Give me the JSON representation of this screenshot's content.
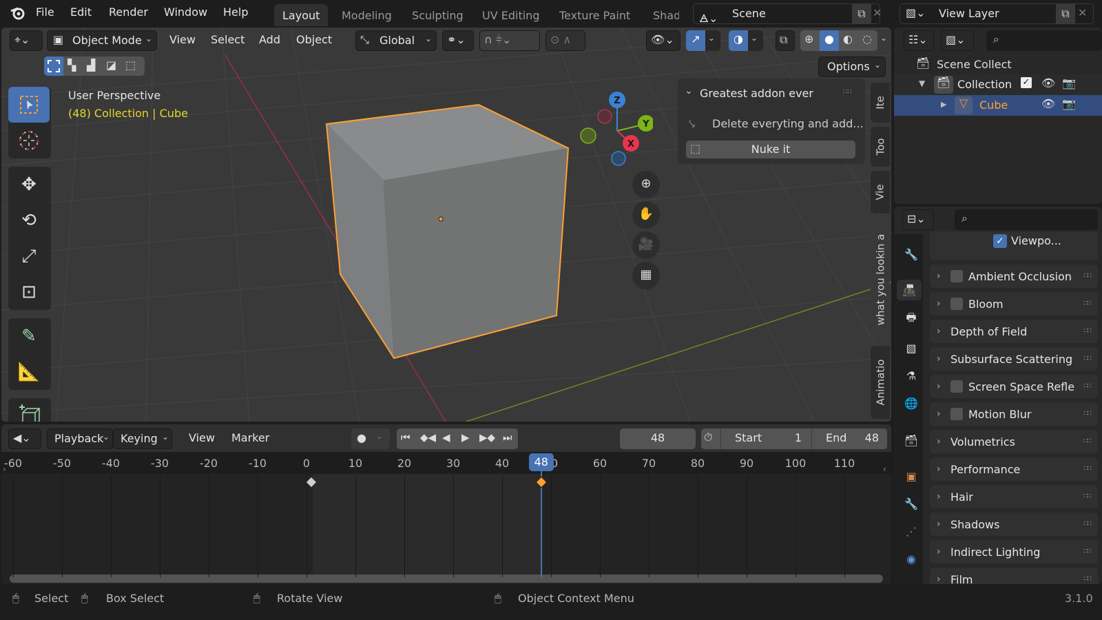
{
  "topbar": {
    "menu": [
      "File",
      "Edit",
      "Render",
      "Window",
      "Help"
    ],
    "workspaces": [
      "Layout",
      "Modeling",
      "Sculpting",
      "UV Editing",
      "Texture Paint",
      "Shadi"
    ],
    "active_workspace": "Layout",
    "scene": "Scene",
    "view_layer": "View Layer"
  },
  "viewport": {
    "mode": "Object Mode",
    "menus": [
      "View",
      "Select",
      "Add",
      "Object"
    ],
    "orientation": "Global",
    "options_label": "Options",
    "title": "User Perspective",
    "subtitle": "(48) Collection | Cube",
    "gizmo": {
      "x": "X",
      "y": "Y",
      "z": "Z"
    },
    "addon_panel": {
      "title": "Greatest addon ever",
      "operator": "Delete everyting and add...",
      "button": "Nuke it"
    },
    "side_tabs": [
      "Ite",
      "Too",
      "Vie",
      "what you lookin a",
      "Animatio"
    ],
    "tools": [
      "select-box",
      "cursor",
      "move",
      "rotate",
      "scale",
      "transform",
      "annotate",
      "measure",
      "add-cube"
    ]
  },
  "outliner": {
    "items": [
      {
        "label": "Scene Collect",
        "level": 0
      },
      {
        "label": "Collection",
        "level": 1
      },
      {
        "label": "Cube",
        "level": 2,
        "selected": true
      }
    ]
  },
  "properties": {
    "viewport_checkbox": "Viewpo...",
    "panels": [
      {
        "label": "Ambient Occlusion",
        "checkbox": true
      },
      {
        "label": "Bloom",
        "checkbox": true
      },
      {
        "label": "Depth of Field",
        "checkbox": false
      },
      {
        "label": "Subsurface Scattering",
        "checkbox": false
      },
      {
        "label": "Screen Space Refle",
        "checkbox": true
      },
      {
        "label": "Motion Blur",
        "checkbox": true
      },
      {
        "label": "Volumetrics",
        "checkbox": false
      },
      {
        "label": "Performance",
        "checkbox": false
      },
      {
        "label": "Hair",
        "checkbox": false
      },
      {
        "label": "Shadows",
        "checkbox": false
      },
      {
        "label": "Indirect Lighting",
        "checkbox": false
      },
      {
        "label": "Film",
        "checkbox": false
      }
    ]
  },
  "timeline": {
    "menus": [
      "Playback",
      "Keying",
      "View",
      "Marker"
    ],
    "current_frame": "48",
    "start_label": "Start",
    "start": "1",
    "end_label": "End",
    "end": "48",
    "ticks": [
      "-60",
      "-50",
      "-40",
      "-30",
      "-20",
      "-10",
      "0",
      "10",
      "20",
      "30",
      "40",
      "50",
      "60",
      "70",
      "80",
      "90",
      "100",
      "110"
    ],
    "keyframes": [
      1,
      48
    ]
  },
  "statusbar": {
    "items": [
      "Select",
      "Box Select",
      "Rotate View",
      "Object Context Menu"
    ],
    "version": "3.1.0"
  },
  "colors": {
    "accent": "#4772b3",
    "selection": "#ffa033",
    "text_yellow": "#e6d72a"
  }
}
